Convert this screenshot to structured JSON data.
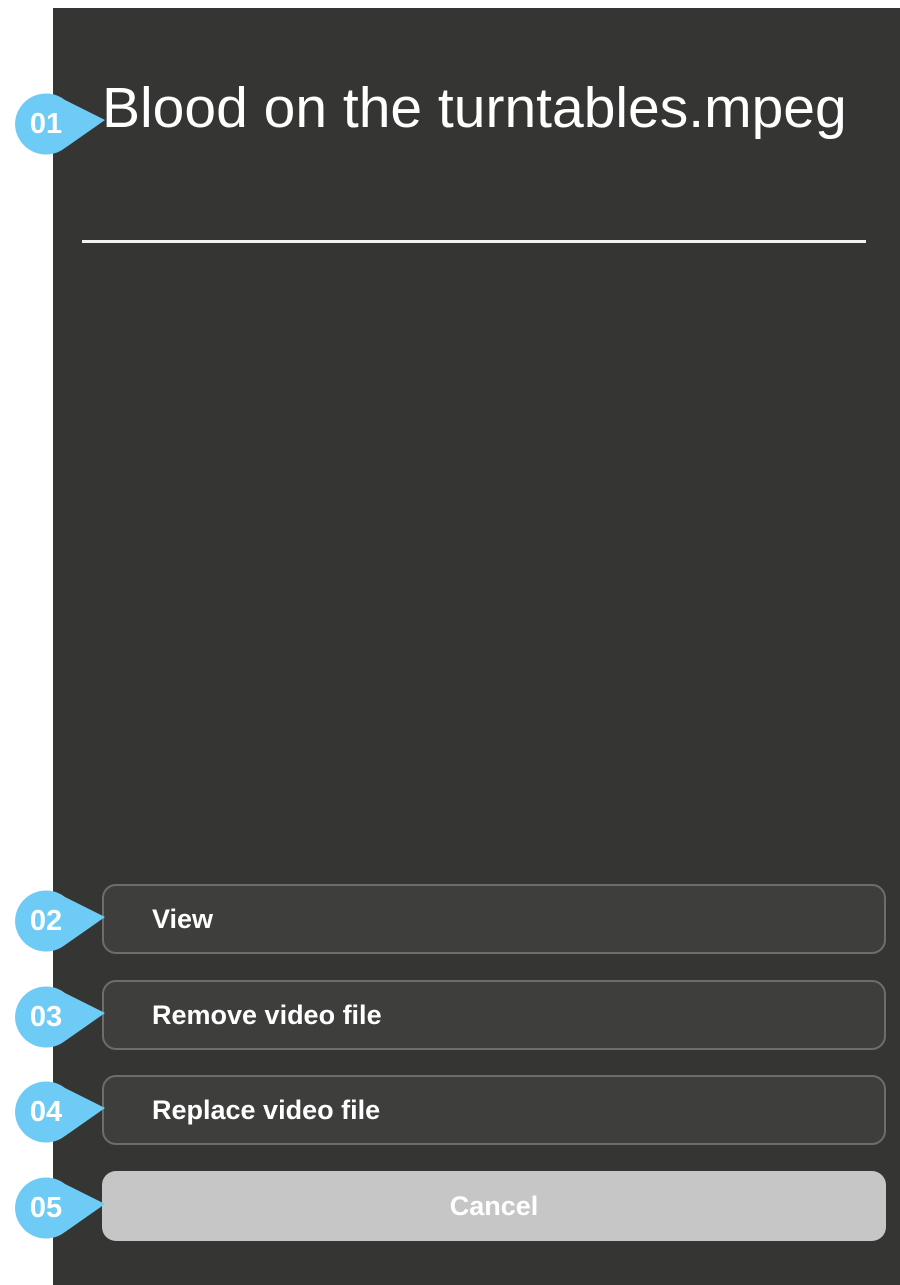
{
  "dialog": {
    "title": "Blood on the turntables.mpeg"
  },
  "actions": {
    "view_label": "View",
    "remove_label": "Remove video file",
    "replace_label": "Replace video file",
    "cancel_label": "Cancel"
  },
  "annotations": {
    "markers": [
      "01",
      "02",
      "03",
      "04",
      "05"
    ],
    "marker_color": "#6ECBF5"
  },
  "colors": {
    "panel_background": "#353533",
    "button_background": "#3E3E3C",
    "button_border": "#6D6D6B",
    "cancel_background": "#C6C6C6",
    "text": "#FFFFFF"
  }
}
